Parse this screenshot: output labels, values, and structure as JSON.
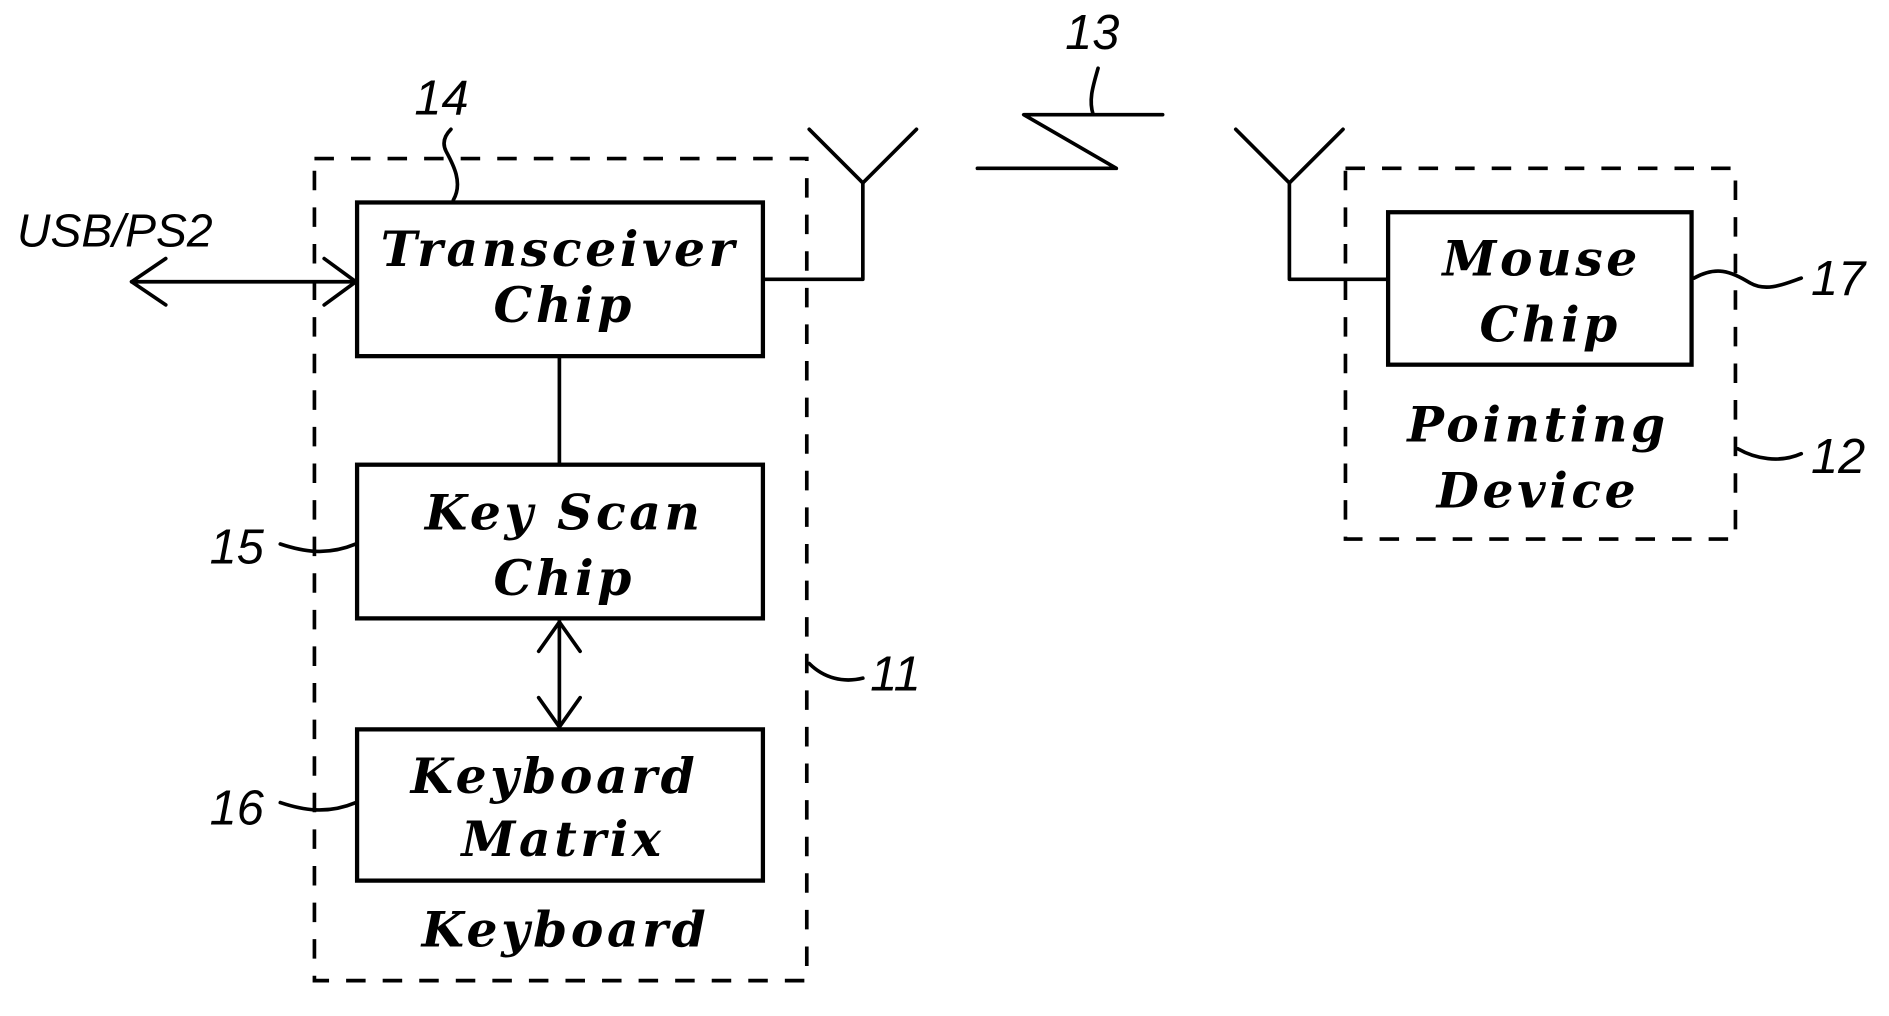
{
  "diagram": {
    "external_interface": "USB/PS2",
    "wireless_link_ref": "13",
    "keyboard": {
      "ref": "11",
      "label": "Keyboard",
      "transceiver": {
        "ref": "14",
        "line1": "Transceiver",
        "line2": "Chip"
      },
      "key_scan": {
        "ref": "15",
        "line1": "Key Scan",
        "line2": "Chip"
      },
      "matrix": {
        "ref": "16",
        "line1": "Keyboard",
        "line2": "Matrix"
      }
    },
    "pointing_device": {
      "ref": "12",
      "line1": "Pointing",
      "line2": "Device",
      "mouse_chip": {
        "ref": "17",
        "line1": "Mouse",
        "line2": "Chip"
      }
    }
  }
}
